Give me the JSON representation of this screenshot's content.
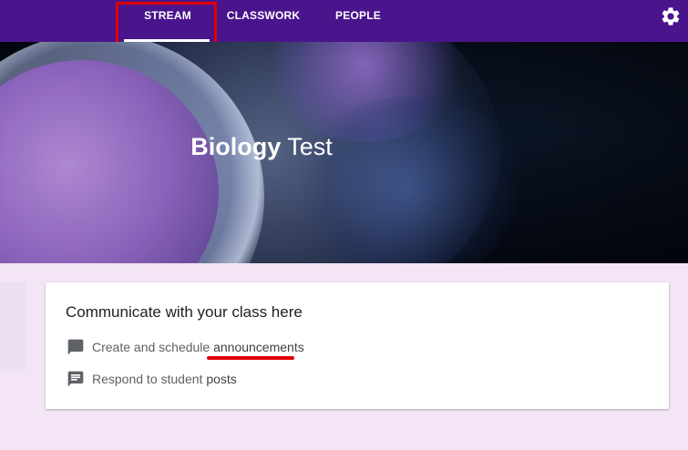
{
  "nav": {
    "tabs": [
      {
        "label": "STREAM",
        "active": true
      },
      {
        "label": "CLASSWORK",
        "active": false
      },
      {
        "label": "PEOPLE",
        "active": false
      }
    ],
    "settings_icon": "gear-icon",
    "bar_color": "#4a148c"
  },
  "banner": {
    "title_bold": "Biology",
    "title_rest": " Test"
  },
  "card": {
    "title": "Communicate with your class here",
    "rows": [
      {
        "icon": "comment-icon",
        "text_plain": "Create and schedule ",
        "text_em": "announcements"
      },
      {
        "icon": "chat-bubble-icon",
        "text_plain": "Respond to student ",
        "text_em": "posts"
      }
    ]
  },
  "colors": {
    "page_background": "#f3e5f5",
    "annotation": "#e00000"
  }
}
